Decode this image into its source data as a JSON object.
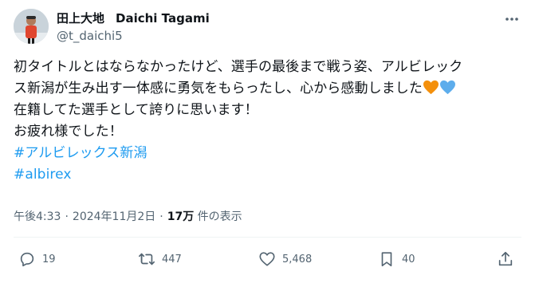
{
  "author": {
    "name_jp": "田上大地",
    "name_en": "Daichi Tagami",
    "handle": "@t_daichi5",
    "avatar_icon": "user-avatar-photo"
  },
  "tweet": {
    "line1": "初タイトルとはならなかったけど、選手の最後まで戦う姿、アルビレック",
    "line2": "ス新潟が生み出す一体感に勇気をもらったし、心から感動しました",
    "line3": "在籍してた選手として誇りに思います！",
    "line4": "お疲れ様でした！",
    "hashtag1": "#アルビレックス新潟",
    "hashtag2": "#albirex",
    "emoji": [
      "orange-heart-icon",
      "blue-heart-icon"
    ]
  },
  "meta": {
    "time": "午後4:33",
    "date": "2024年11月2日",
    "separator": "·",
    "views_count": "17万",
    "views_label": "件の表示"
  },
  "actions": {
    "replies": "19",
    "retweets": "447",
    "likes": "5,468",
    "bookmarks": "40"
  },
  "colors": {
    "text": "#0f1419",
    "secondary": "#536471",
    "link": "#1d9bf0",
    "orange_heart": "#f4900c",
    "blue_heart": "#5dadec"
  }
}
